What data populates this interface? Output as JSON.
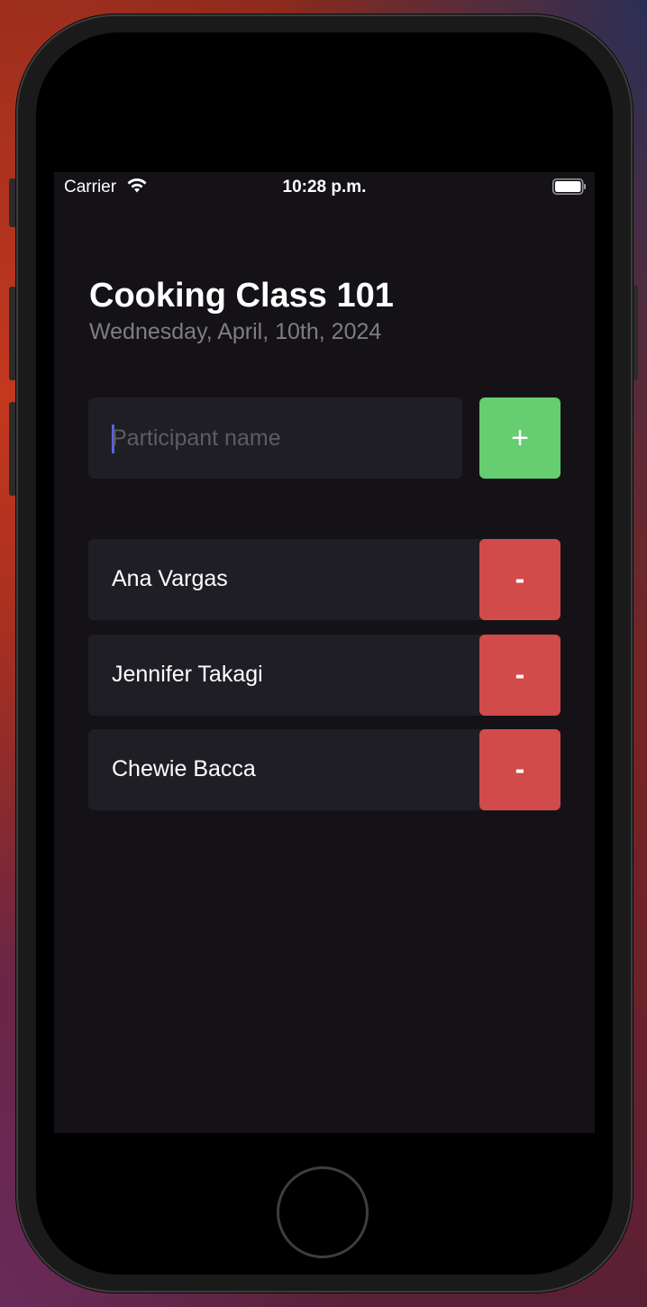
{
  "status_bar": {
    "carrier": "Carrier",
    "time": "10:28 p.m."
  },
  "header": {
    "title": "Cooking Class 101",
    "date": "Wednesday, April, 10th, 2024"
  },
  "form": {
    "placeholder": "Participant name",
    "add_label": "+"
  },
  "participants": [
    {
      "name": "Ana Vargas",
      "remove_label": "-"
    },
    {
      "name": "Jennifer Takagi",
      "remove_label": "-"
    },
    {
      "name": "Chewie Bacca",
      "remove_label": "-"
    }
  ],
  "colors": {
    "background": "#141217",
    "card": "#1f1e24",
    "add_button": "#66cd71",
    "remove_button": "#d14b4a",
    "subtitle": "#7e7d83",
    "caret": "#5b63d8"
  }
}
